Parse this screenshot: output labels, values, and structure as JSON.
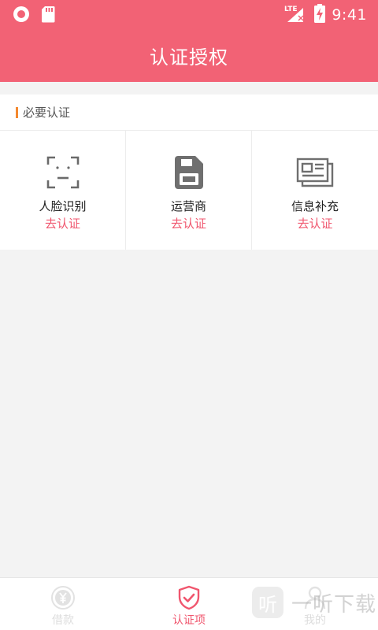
{
  "status_bar": {
    "time": "9:41",
    "network": "LTE"
  },
  "header": {
    "title": "认证授权"
  },
  "section": {
    "title": "必要认证"
  },
  "items": [
    {
      "label": "人脸识别",
      "action": "去认证",
      "icon": "face-scan-icon"
    },
    {
      "label": "运营商",
      "action": "去认证",
      "icon": "sim-card-icon"
    },
    {
      "label": "信息补充",
      "action": "去认证",
      "icon": "id-card-icon"
    }
  ],
  "bottom_nav": [
    {
      "label": "借款",
      "icon": "yen-coin-icon",
      "active": false
    },
    {
      "label": "认证项",
      "icon": "shield-check-icon",
      "active": true
    },
    {
      "label": "我的",
      "icon": "person-icon",
      "active": false
    }
  ],
  "watermark": {
    "text": "一听下载",
    "logo_char": "听"
  },
  "colors": {
    "brand": "#f26275",
    "accent_text": "#f0566e",
    "marker": "#f4892f",
    "background": "#f3f3f3"
  }
}
